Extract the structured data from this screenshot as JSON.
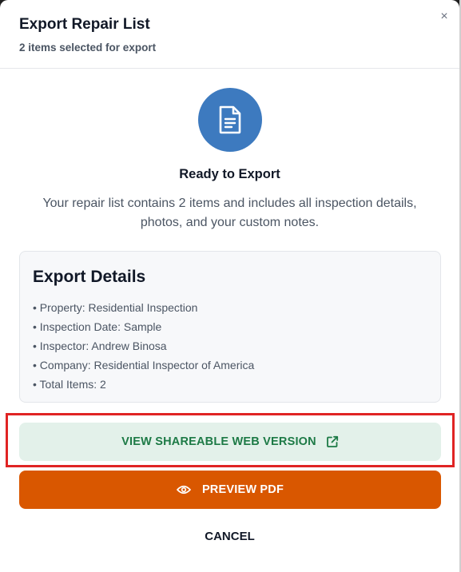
{
  "header": {
    "title": "Export Repair List",
    "subtitle": "2 items selected for export",
    "close_glyph": "×"
  },
  "hero": {
    "icon": "document-icon",
    "heading": "Ready to Export",
    "description": "Your repair list contains 2 items and includes all inspection details, photos, and your custom notes."
  },
  "details": {
    "title": "Export Details",
    "items": [
      "Property: Residential Inspection",
      "Inspection Date: Sample",
      "Inspector: Andrew Binosa",
      "Company: Residential Inspector of America",
      "Total Items: 2"
    ]
  },
  "actions": {
    "web_label": "VIEW SHAREABLE WEB VERSION",
    "pdf_label": "PREVIEW PDF",
    "cancel_label": "CANCEL"
  },
  "colors": {
    "accent_blue": "#3d7abf",
    "web_bg": "#e3f1ea",
    "web_text": "#1d7a46",
    "pdf_bg": "#d95700",
    "highlight": "#e02424"
  }
}
